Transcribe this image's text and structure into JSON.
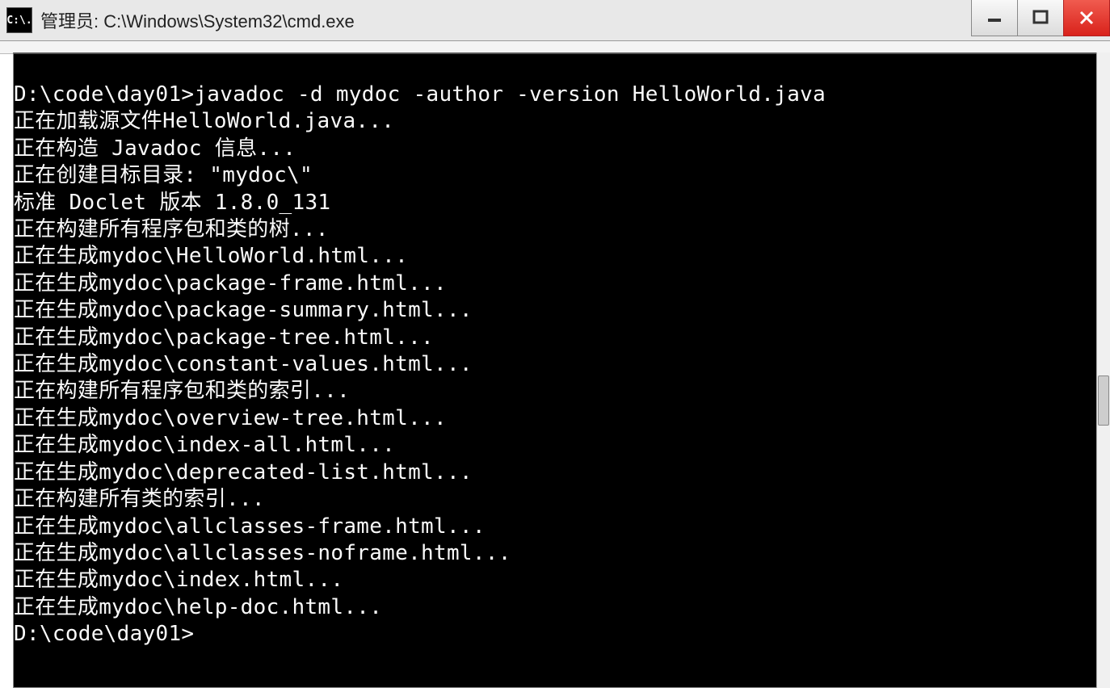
{
  "window": {
    "title": "管理员: C:\\Windows\\System32\\cmd.exe",
    "icon_label": "C:\\."
  },
  "terminal": {
    "prompt1": "D:\\code\\day01>",
    "command": "javadoc -d mydoc -author -version HelloWorld.java",
    "lines": [
      "正在加载源文件HelloWorld.java...",
      "正在构造 Javadoc 信息...",
      "正在创建目标目录: \"mydoc\\\"",
      "标准 Doclet 版本 1.8.0_131",
      "正在构建所有程序包和类的树...",
      "正在生成mydoc\\HelloWorld.html...",
      "正在生成mydoc\\package-frame.html...",
      "正在生成mydoc\\package-summary.html...",
      "正在生成mydoc\\package-tree.html...",
      "正在生成mydoc\\constant-values.html...",
      "正在构建所有程序包和类的索引...",
      "正在生成mydoc\\overview-tree.html...",
      "正在生成mydoc\\index-all.html...",
      "正在生成mydoc\\deprecated-list.html...",
      "正在构建所有类的索引...",
      "正在生成mydoc\\allclasses-frame.html...",
      "正在生成mydoc\\allclasses-noframe.html...",
      "正在生成mydoc\\index.html...",
      "正在生成mydoc\\help-doc.html..."
    ],
    "prompt2": "D:\\code\\day01>"
  }
}
